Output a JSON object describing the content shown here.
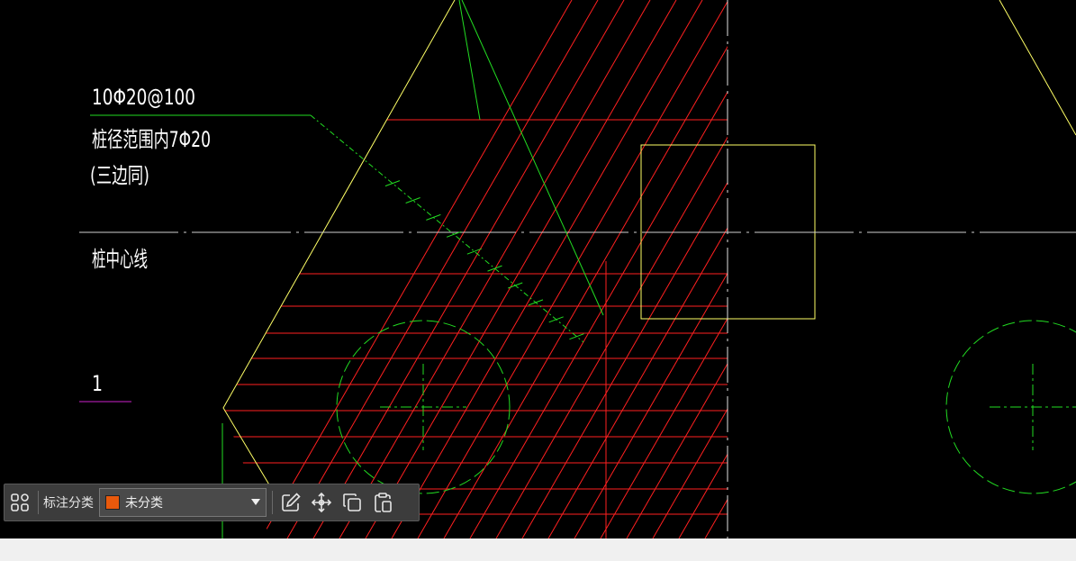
{
  "drawing": {
    "text_rebar_spec": "10Φ20@100",
    "text_pile_range": "桩径范围内7Φ20",
    "text_three_sides": "(三边同)",
    "text_pile_centerline": "桩中心线",
    "text_section_mark": "1"
  },
  "toolbar": {
    "annotation_label": "标注分类",
    "category_value": "未分类",
    "category_color": "#e8590c",
    "icons": [
      "grid-layout-icon",
      "edit-icon",
      "move-icon",
      "copy-icon",
      "paste-icon"
    ]
  },
  "colors": {
    "background": "#000000",
    "hatch": "#ff2020",
    "outline": "#ffff66",
    "leader": "#22dd22",
    "centerline": "#d0d0d0",
    "section_underline": "#cc22cc"
  }
}
